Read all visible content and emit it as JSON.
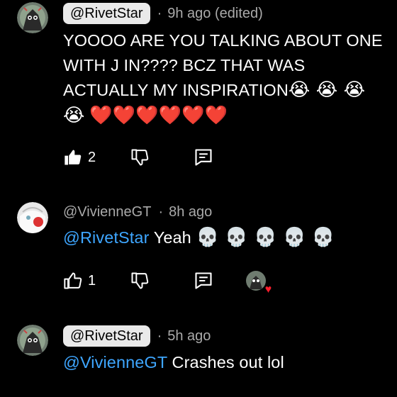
{
  "comments": [
    {
      "handle": "@RivetStar",
      "handle_style": "chip",
      "time": "9h ago (edited)",
      "text": "YOOOO ARE YOU TALKING ABOUT ONE WITH J IN???? BCZ THAT WAS ACTUALLY MY INSPIRATION",
      "emojis_line1": "😭 😭 😭",
      "emojis_line2": "😭",
      "hearts": "❤️❤️❤️❤️❤️❤️",
      "likes": "2"
    },
    {
      "handle": "@VivienneGT",
      "handle_style": "plain",
      "time": "8h ago",
      "mention": "@RivetStar",
      "text": "Yeah",
      "emojis": "💀 💀 💀 💀 💀",
      "likes": "1"
    },
    {
      "handle": "@RivetStar",
      "handle_style": "chip",
      "time": "5h ago",
      "mention": "@VivienneGT",
      "text": "Crashes out lol"
    }
  ],
  "colors": {
    "background": "#000000",
    "mention": "#3ea6ff",
    "secondary_text": "#aaaaaa",
    "chip_bg": "#e9e9e9",
    "heart": "#ff1e2d"
  },
  "icons": [
    "like-icon",
    "dislike-icon",
    "reply-icon",
    "heart-icon"
  ]
}
